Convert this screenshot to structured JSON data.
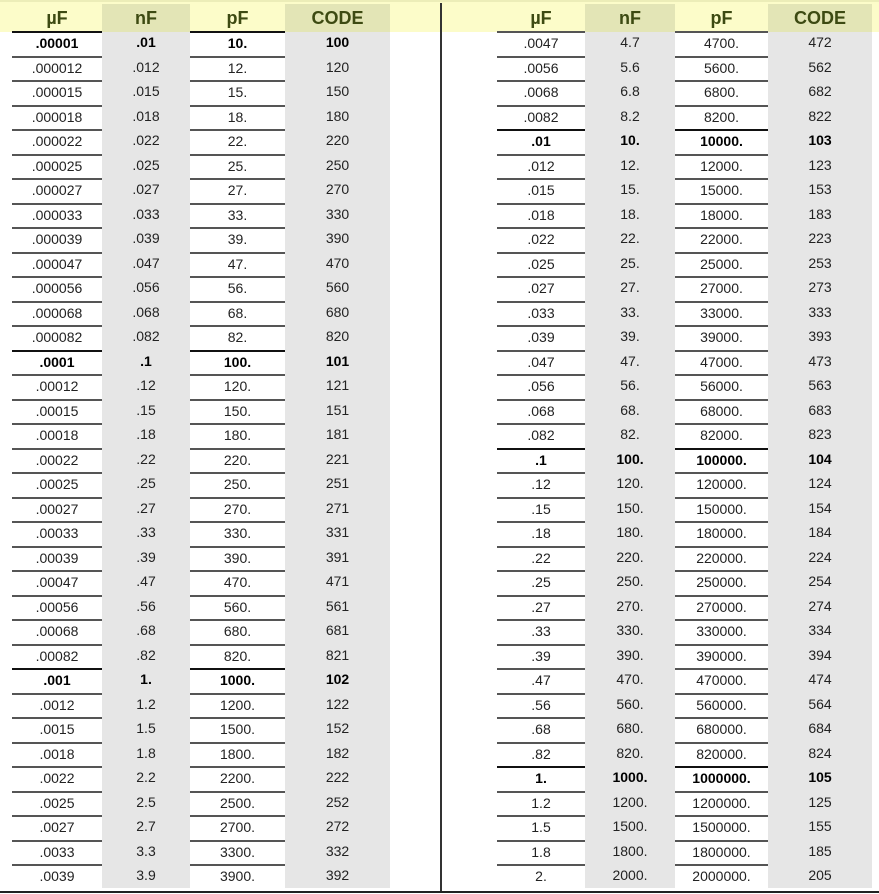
{
  "headers": [
    "µF",
    "nF",
    "pF",
    "CODE"
  ],
  "colors": {
    "header_band": "#fcfcc9",
    "header_text": "#3d4a12",
    "shaded_column": "#e6e6e6"
  },
  "left_table": {
    "rows": [
      {
        "uf": ".00001",
        "nf": ".01",
        "pf": "10.",
        "code": "100",
        "bold": true
      },
      {
        "uf": ".000012",
        "nf": ".012",
        "pf": "12.",
        "code": "120"
      },
      {
        "uf": ".000015",
        "nf": ".015",
        "pf": "15.",
        "code": "150"
      },
      {
        "uf": ".000018",
        "nf": ".018",
        "pf": "18.",
        "code": "180"
      },
      {
        "uf": ".000022",
        "nf": ".022",
        "pf": "22.",
        "code": "220"
      },
      {
        "uf": ".000025",
        "nf": ".025",
        "pf": "25.",
        "code": "250"
      },
      {
        "uf": ".000027",
        "nf": ".027",
        "pf": "27.",
        "code": "270"
      },
      {
        "uf": ".000033",
        "nf": ".033",
        "pf": "33.",
        "code": "330"
      },
      {
        "uf": ".000039",
        "nf": ".039",
        "pf": "39.",
        "code": "390"
      },
      {
        "uf": ".000047",
        "nf": ".047",
        "pf": "47.",
        "code": "470"
      },
      {
        "uf": ".000056",
        "nf": ".056",
        "pf": "56.",
        "code": "560"
      },
      {
        "uf": ".000068",
        "nf": ".068",
        "pf": "68.",
        "code": "680"
      },
      {
        "uf": ".000082",
        "nf": ".082",
        "pf": "82.",
        "code": "820"
      },
      {
        "uf": ".0001",
        "nf": ".1",
        "pf": "100.",
        "code": "101",
        "bold": true
      },
      {
        "uf": ".00012",
        "nf": ".12",
        "pf": "120.",
        "code": "121"
      },
      {
        "uf": ".00015",
        "nf": ".15",
        "pf": "150.",
        "code": "151"
      },
      {
        "uf": ".00018",
        "nf": ".18",
        "pf": "180.",
        "code": "181"
      },
      {
        "uf": ".00022",
        "nf": ".22",
        "pf": "220.",
        "code": "221"
      },
      {
        "uf": ".00025",
        "nf": ".25",
        "pf": "250.",
        "code": "251"
      },
      {
        "uf": ".00027",
        "nf": ".27",
        "pf": "270.",
        "code": "271"
      },
      {
        "uf": ".00033",
        "nf": ".33",
        "pf": "330.",
        "code": "331"
      },
      {
        "uf": ".00039",
        "nf": ".39",
        "pf": "390.",
        "code": "391"
      },
      {
        "uf": ".00047",
        "nf": ".47",
        "pf": "470.",
        "code": "471"
      },
      {
        "uf": ".00056",
        "nf": ".56",
        "pf": "560.",
        "code": "561"
      },
      {
        "uf": ".00068",
        "nf": ".68",
        "pf": "680.",
        "code": "681"
      },
      {
        "uf": ".00082",
        "nf": ".82",
        "pf": "820.",
        "code": "821"
      },
      {
        "uf": ".001",
        "nf": "1.",
        "pf": "1000.",
        "code": "102",
        "bold": true
      },
      {
        "uf": ".0012",
        "nf": "1.2",
        "pf": "1200.",
        "code": "122"
      },
      {
        "uf": ".0015",
        "nf": "1.5",
        "pf": "1500.",
        "code": "152"
      },
      {
        "uf": ".0018",
        "nf": "1.8",
        "pf": "1800.",
        "code": "182"
      },
      {
        "uf": ".0022",
        "nf": "2.2",
        "pf": "2200.",
        "code": "222"
      },
      {
        "uf": ".0025",
        "nf": "2.5",
        "pf": "2500.",
        "code": "252"
      },
      {
        "uf": ".0027",
        "nf": "2.7",
        "pf": "2700.",
        "code": "272"
      },
      {
        "uf": ".0033",
        "nf": "3.3",
        "pf": "3300.",
        "code": "332"
      },
      {
        "uf": ".0039",
        "nf": "3.9",
        "pf": "3900.",
        "code": "392"
      }
    ]
  },
  "right_table": {
    "rows": [
      {
        "uf": ".0047",
        "nf": "4.7",
        "pf": "4700.",
        "code": "472"
      },
      {
        "uf": ".0056",
        "nf": "5.6",
        "pf": "5600.",
        "code": "562"
      },
      {
        "uf": ".0068",
        "nf": "6.8",
        "pf": "6800.",
        "code": "682"
      },
      {
        "uf": ".0082",
        "nf": "8.2",
        "pf": "8200.",
        "code": "822"
      },
      {
        "uf": ".01",
        "nf": "10.",
        "pf": "10000.",
        "code": "103",
        "bold": true
      },
      {
        "uf": ".012",
        "nf": "12.",
        "pf": "12000.",
        "code": "123"
      },
      {
        "uf": ".015",
        "nf": "15.",
        "pf": "15000.",
        "code": "153"
      },
      {
        "uf": ".018",
        "nf": "18.",
        "pf": "18000.",
        "code": "183"
      },
      {
        "uf": ".022",
        "nf": "22.",
        "pf": "22000.",
        "code": "223"
      },
      {
        "uf": ".025",
        "nf": "25.",
        "pf": "25000.",
        "code": "253"
      },
      {
        "uf": ".027",
        "nf": "27.",
        "pf": "27000.",
        "code": "273"
      },
      {
        "uf": ".033",
        "nf": "33.",
        "pf": "33000.",
        "code": "333"
      },
      {
        "uf": ".039",
        "nf": "39.",
        "pf": "39000.",
        "code": "393"
      },
      {
        "uf": ".047",
        "nf": "47.",
        "pf": "47000.",
        "code": "473"
      },
      {
        "uf": ".056",
        "nf": "56.",
        "pf": "56000.",
        "code": "563"
      },
      {
        "uf": ".068",
        "nf": "68.",
        "pf": "68000.",
        "code": "683"
      },
      {
        "uf": ".082",
        "nf": "82.",
        "pf": "82000.",
        "code": "823"
      },
      {
        "uf": ".1",
        "nf": "100.",
        "pf": "100000.",
        "code": "104",
        "bold": true
      },
      {
        "uf": ".12",
        "nf": "120.",
        "pf": "120000.",
        "code": "124"
      },
      {
        "uf": ".15",
        "nf": "150.",
        "pf": "150000.",
        "code": "154"
      },
      {
        "uf": ".18",
        "nf": "180.",
        "pf": "180000.",
        "code": "184"
      },
      {
        "uf": ".22",
        "nf": "220.",
        "pf": "220000.",
        "code": "224"
      },
      {
        "uf": ".25",
        "nf": "250.",
        "pf": "250000.",
        "code": "254"
      },
      {
        "uf": ".27",
        "nf": "270.",
        "pf": "270000.",
        "code": "274"
      },
      {
        "uf": ".33",
        "nf": "330.",
        "pf": "330000.",
        "code": "334"
      },
      {
        "uf": ".39",
        "nf": "390.",
        "pf": "390000.",
        "code": "394"
      },
      {
        "uf": ".47",
        "nf": "470.",
        "pf": "470000.",
        "code": "474"
      },
      {
        "uf": ".56",
        "nf": "560.",
        "pf": "560000.",
        "code": "564"
      },
      {
        "uf": ".68",
        "nf": "680.",
        "pf": "680000.",
        "code": "684"
      },
      {
        "uf": ".82",
        "nf": "820.",
        "pf": "820000.",
        "code": "824"
      },
      {
        "uf": "1.",
        "nf": "1000.",
        "pf": "1000000.",
        "code": "105",
        "bold": true
      },
      {
        "uf": "1.2",
        "nf": "1200.",
        "pf": "1200000.",
        "code": "125"
      },
      {
        "uf": "1.5",
        "nf": "1500.",
        "pf": "1500000.",
        "code": "155"
      },
      {
        "uf": "1.8",
        "nf": "1800.",
        "pf": "1800000.",
        "code": "185"
      },
      {
        "uf": "2.",
        "nf": "2000.",
        "pf": "2000000.",
        "code": "205"
      }
    ]
  }
}
